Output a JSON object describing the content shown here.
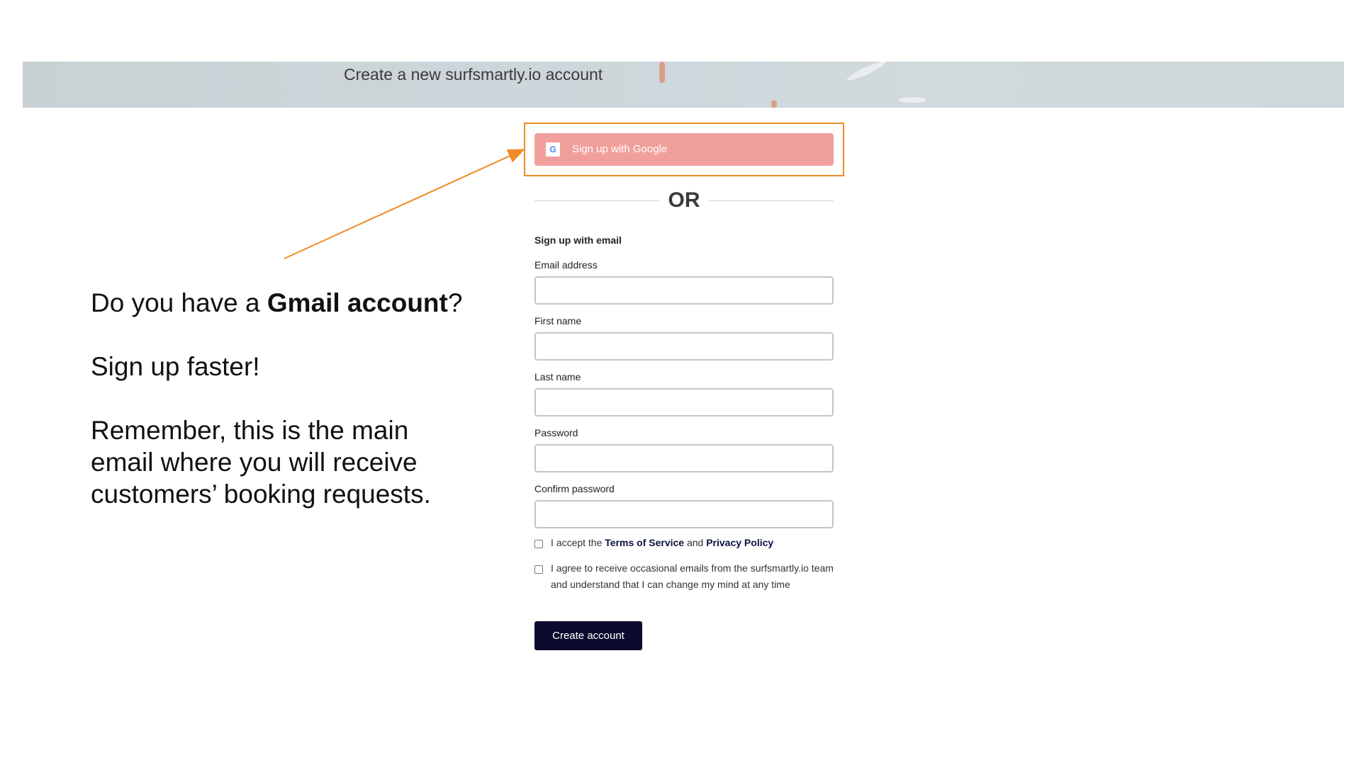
{
  "banner": {
    "title": "Create a new surfsmartly.io account"
  },
  "instructions": {
    "line1_prefix": "Do you have a ",
    "line1_bold": "Gmail account",
    "line1_suffix": "?",
    "line2": "Sign up faster!",
    "line3": "Remember, this is the main email where you will receive customers’ booking requests."
  },
  "google": {
    "label": "Sign up with Google",
    "logo": "G",
    "icon": "google-g-icon"
  },
  "divider": {
    "text": "OR"
  },
  "form": {
    "heading": "Sign up with email",
    "fields": [
      {
        "label": "Email address",
        "value": ""
      },
      {
        "label": "First name",
        "value": ""
      },
      {
        "label": "Last name",
        "value": ""
      },
      {
        "label": "Password",
        "value": ""
      },
      {
        "label": "Confirm password",
        "value": ""
      }
    ],
    "terms": {
      "prefix": "I accept the ",
      "terms_link": "Terms of Service",
      "middle": " and ",
      "privacy_link": "Privacy Policy",
      "checked": false
    },
    "marketing": {
      "text": "I agree to receive occasional emails from the surfsmartly.io team and understand that I can change my mind at any time",
      "checked": false
    },
    "submit_label": "Create account"
  },
  "colors": {
    "highlight": "#f08a24",
    "google_button": "#f19f9c",
    "submit_button": "#0b0b2e",
    "banner": "#cdd6da"
  }
}
